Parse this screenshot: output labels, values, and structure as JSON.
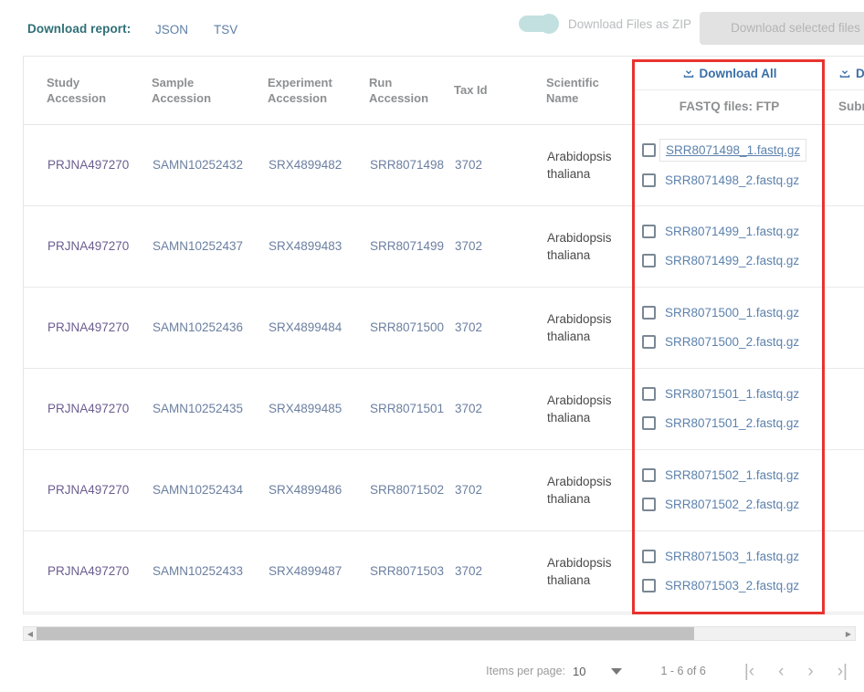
{
  "toolbar": {
    "download_report_label": "Download report:",
    "formats": [
      {
        "label": "JSON",
        "name": "json"
      },
      {
        "label": "TSV",
        "name": "tsv"
      }
    ],
    "zip_toggle_label": "Download Files as ZIP",
    "zip_toggle_state": "off",
    "download_selected_label": "Download selected files",
    "download_selected_disabled": true
  },
  "table": {
    "columns": [
      {
        "key": "study",
        "line1": "Study",
        "line2": "Accession"
      },
      {
        "key": "sample",
        "line1": "Sample",
        "line2": "Accession"
      },
      {
        "key": "experiment",
        "line1": "Experiment",
        "line2": "Accession"
      },
      {
        "key": "run",
        "line1": "Run",
        "line2": "Accession"
      },
      {
        "key": "taxid",
        "line1": "Tax Id",
        "line2": ""
      },
      {
        "key": "sci",
        "line1": "Scientific",
        "line2": "Name"
      }
    ],
    "fastq_column": {
      "download_all_label": "Download All",
      "subheader": "FASTQ files: FTP"
    },
    "submitted_column": {
      "download_all_label": "Do",
      "subheader": "Subm"
    },
    "rows": [
      {
        "study": "PRJNA497270",
        "sample": "SAMN10252432",
        "experiment": "SRX4899482",
        "run": "SRR8071498",
        "taxid": "3702",
        "sci": "Arabidopsis thaliana",
        "files": [
          {
            "name": "SRR8071498_1.fastq.gz",
            "checked": false,
            "hovered": true
          },
          {
            "name": "SRR8071498_2.fastq.gz",
            "checked": false,
            "hovered": false
          }
        ]
      },
      {
        "study": "PRJNA497270",
        "sample": "SAMN10252437",
        "experiment": "SRX4899483",
        "run": "SRR8071499",
        "taxid": "3702",
        "sci": "Arabidopsis thaliana",
        "files": [
          {
            "name": "SRR8071499_1.fastq.gz",
            "checked": false,
            "hovered": false
          },
          {
            "name": "SRR8071499_2.fastq.gz",
            "checked": false,
            "hovered": false
          }
        ]
      },
      {
        "study": "PRJNA497270",
        "sample": "SAMN10252436",
        "experiment": "SRX4899484",
        "run": "SRR8071500",
        "taxid": "3702",
        "sci": "Arabidopsis thaliana",
        "files": [
          {
            "name": "SRR8071500_1.fastq.gz",
            "checked": false,
            "hovered": false
          },
          {
            "name": "SRR8071500_2.fastq.gz",
            "checked": false,
            "hovered": false
          }
        ]
      },
      {
        "study": "PRJNA497270",
        "sample": "SAMN10252435",
        "experiment": "SRX4899485",
        "run": "SRR8071501",
        "taxid": "3702",
        "sci": "Arabidopsis thaliana",
        "files": [
          {
            "name": "SRR8071501_1.fastq.gz",
            "checked": false,
            "hovered": false
          },
          {
            "name": "SRR8071501_2.fastq.gz",
            "checked": false,
            "hovered": false
          }
        ]
      },
      {
        "study": "PRJNA497270",
        "sample": "SAMN10252434",
        "experiment": "SRX4899486",
        "run": "SRR8071502",
        "taxid": "3702",
        "sci": "Arabidopsis thaliana",
        "files": [
          {
            "name": "SRR8071502_1.fastq.gz",
            "checked": false,
            "hovered": false
          },
          {
            "name": "SRR8071502_2.fastq.gz",
            "checked": false,
            "hovered": false
          }
        ]
      },
      {
        "study": "PRJNA497270",
        "sample": "SAMN10252433",
        "experiment": "SRX4899487",
        "run": "SRR8071503",
        "taxid": "3702",
        "sci": "Arabidopsis thaliana",
        "files": [
          {
            "name": "SRR8071503_1.fastq.gz",
            "checked": false,
            "hovered": false
          },
          {
            "name": "SRR8071503_2.fastq.gz",
            "checked": false,
            "hovered": false
          }
        ]
      }
    ]
  },
  "paginator": {
    "items_per_page_label": "Items per page:",
    "items_per_page_value": "10",
    "range_label": "1 - 6 of 6",
    "buttons": [
      {
        "name": "first-page-button",
        "glyph": "|‹"
      },
      {
        "name": "previous-page-button",
        "glyph": "‹"
      },
      {
        "name": "next-page-button",
        "glyph": "›"
      },
      {
        "name": "last-page-button",
        "glyph": "›|"
      }
    ]
  },
  "colors": {
    "accent_teal": "#2e6f76",
    "link_blue": "#5d82ad",
    "study_purple": "#6c5d8f",
    "highlight_red": "#e8332f",
    "toggle_teal": "#c3e0e0"
  }
}
